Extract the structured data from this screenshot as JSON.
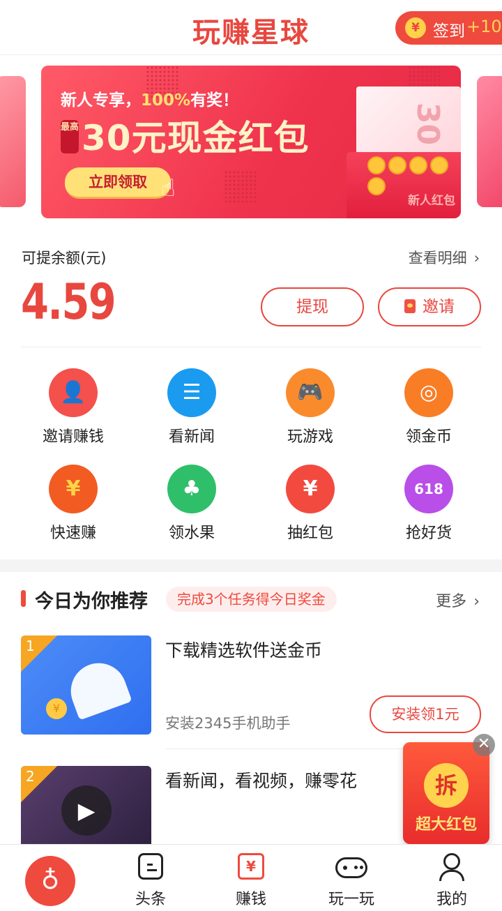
{
  "header": {
    "app_title": "玩赚星球",
    "signin_label": "签到",
    "signin_bonus": "+10",
    "coin_symbol": "¥"
  },
  "banner": {
    "line1_prefix": "新人专享，",
    "line1_pct": "100%",
    "line1_suffix": "有奖！",
    "tag": "最高",
    "headline": "30元现金红包",
    "button": "立即领取",
    "envelope_label": "新人红包",
    "note_value": "30"
  },
  "wallet": {
    "balance_label": "可提余额(元)",
    "detail_link": "查看明细",
    "amount": "4.59",
    "withdraw_button": "提现",
    "invite_button": "邀请"
  },
  "features": [
    {
      "label": "邀请赚钱",
      "icon": "invite-person-icon",
      "color": "#f4504c"
    },
    {
      "label": "看新闻",
      "icon": "news-icon",
      "color": "#1a9bf0"
    },
    {
      "label": "玩游戏",
      "icon": "gamepad-icon",
      "color": "#f98b2d"
    },
    {
      "label": "领金币",
      "icon": "coin-stack-icon",
      "color": "#f97d25"
    },
    {
      "label": "快速赚",
      "icon": "fast-earn-icon",
      "color": "#f25b22"
    },
    {
      "label": "领水果",
      "icon": "fruit-tree-icon",
      "color": "#2fbf6a"
    },
    {
      "label": "抽红包",
      "icon": "red-envelope-icon",
      "color": "#f24a3f"
    },
    {
      "label": "抢好货",
      "icon": "shopping-618-icon",
      "color": "#b94ee8",
      "badge": "618"
    }
  ],
  "recommend": {
    "title": "今日为你推荐",
    "pill": "完成3个任务得今日奖金",
    "more": "更多",
    "tasks": [
      {
        "num": "1",
        "title": "下载精选软件送金币",
        "subtitle": "安装2345手机助手",
        "button": "安装领1元"
      },
      {
        "num": "2",
        "title": "看新闻，看视频，赚零花",
        "subtitle": "",
        "button": ""
      }
    ]
  },
  "float_envelope": {
    "seal": "拆",
    "text": "超大红包",
    "close": "✕"
  },
  "tabbar": [
    {
      "label": "",
      "icon": "planet-home-icon"
    },
    {
      "label": "头条",
      "icon": "headline-icon"
    },
    {
      "label": "赚钱",
      "icon": "calendar-money-icon"
    },
    {
      "label": "玩一玩",
      "icon": "gamepad-tab-icon"
    },
    {
      "label": "我的",
      "icon": "profile-icon"
    }
  ],
  "colors": {
    "accent": "#e8473f",
    "gold": "#ffd24a"
  }
}
